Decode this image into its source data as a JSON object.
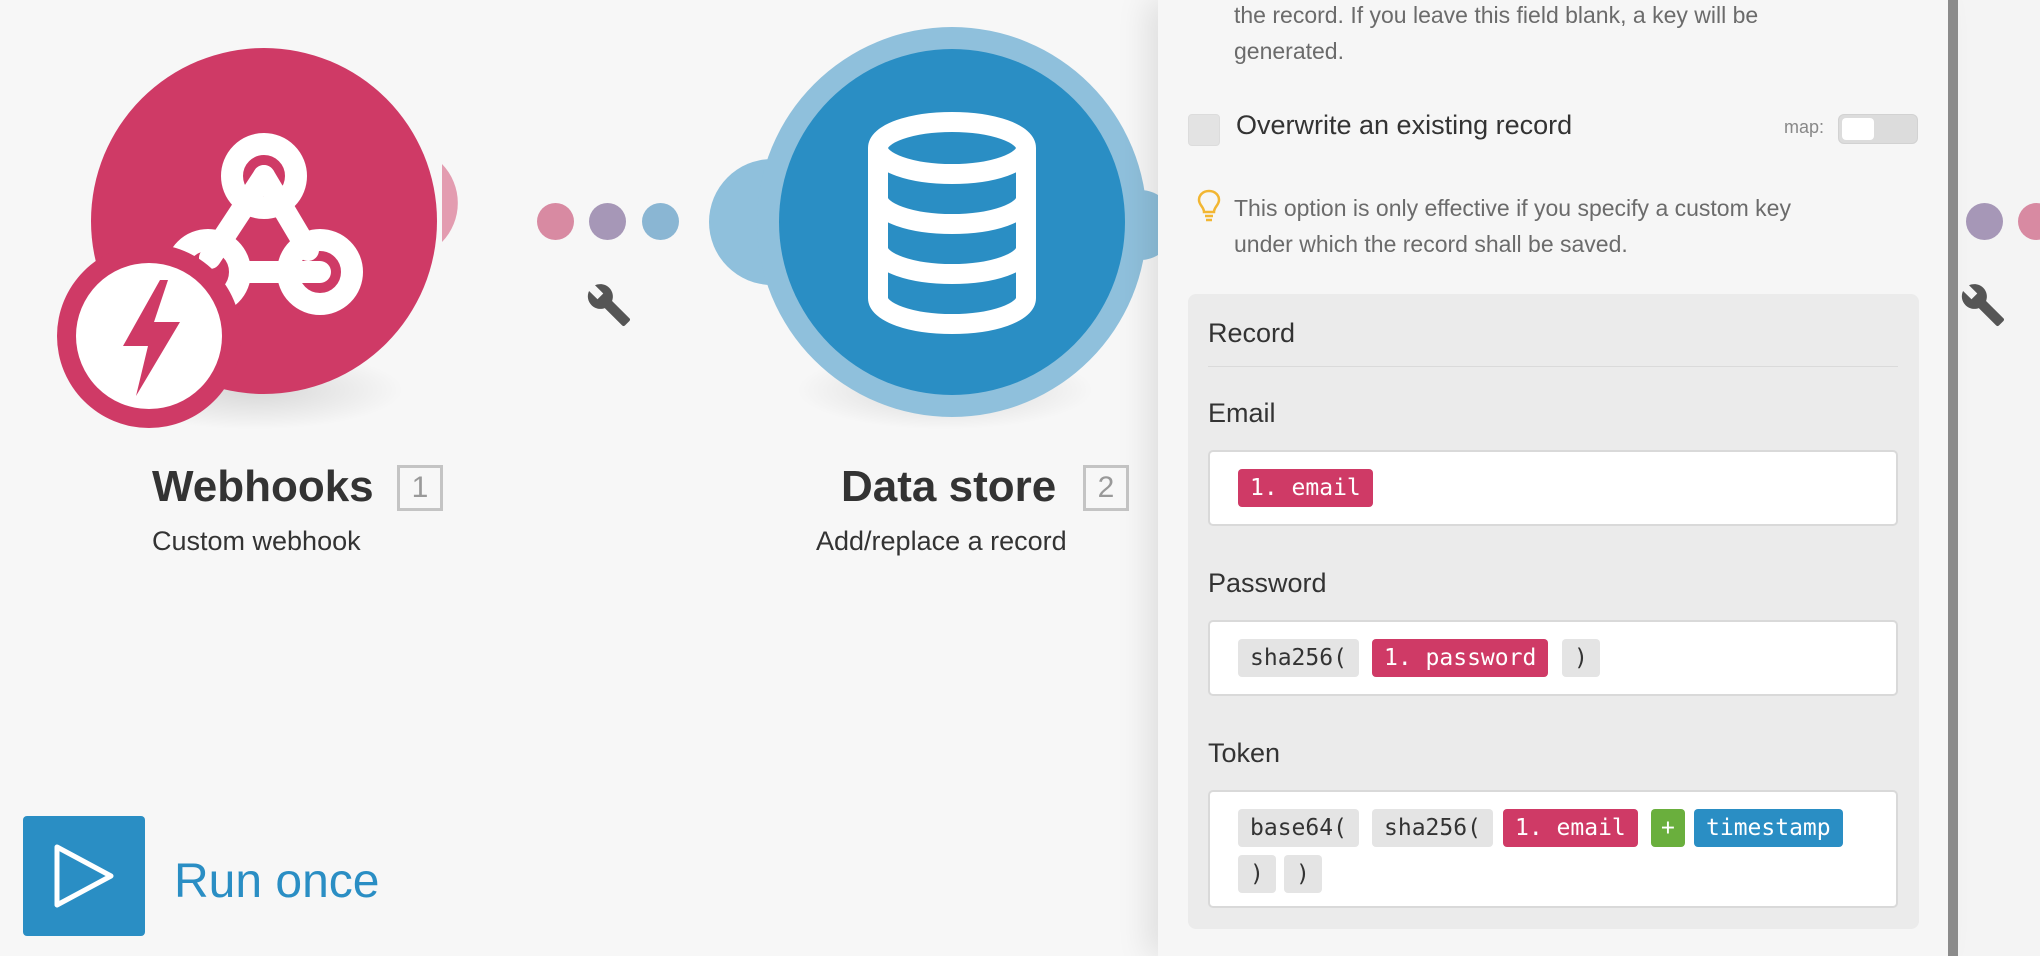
{
  "canvas": {
    "modules": [
      {
        "name": "Webhooks",
        "badge": "1",
        "subtitle": "Custom webhook",
        "color": "#cf3a66"
      },
      {
        "name": "Data store",
        "badge": "2",
        "subtitle": "Add/replace a record",
        "color": "#2a8ec4"
      }
    ],
    "run_once_label": "Run once",
    "icons": [
      "webhook-icon",
      "lightning-icon",
      "database-icon",
      "wrench-icon",
      "play-icon"
    ]
  },
  "panel": {
    "key_help": "the record. If you leave this field blank, a key will be generated.",
    "key_help_lines": [
      "the record. If you leave this field blank, a key will be",
      "generated."
    ],
    "overwrite_label": "Overwrite an existing record",
    "overwrite_checked": false,
    "map_label": "map:",
    "overwrite_help_lines": [
      "This option is only effective if you specify a custom key",
      "under which the record shall be saved."
    ],
    "record": {
      "title": "Record",
      "fields": [
        {
          "label": "Email",
          "tokens": [
            {
              "text": "1. email",
              "kind": "var"
            }
          ]
        },
        {
          "label": "Password",
          "tokens": [
            {
              "text": "sha256(",
              "kind": "fn"
            },
            {
              "text": "1. password",
              "kind": "var"
            },
            {
              "text": ")",
              "kind": "fn"
            }
          ]
        },
        {
          "label": "Token",
          "tokens": [
            {
              "text": "base64(",
              "kind": "fn"
            },
            {
              "text": "sha256(",
              "kind": "fn"
            },
            {
              "text": "1. email",
              "kind": "var"
            },
            {
              "text": "+",
              "kind": "op"
            },
            {
              "text": "timestamp",
              "kind": "kw"
            },
            {
              "text": ")",
              "kind": "fn"
            },
            {
              "text": ")",
              "kind": "fn"
            }
          ]
        }
      ]
    }
  },
  "colors": {
    "webhook": "#cf3a66",
    "datastore": "#2a8ec4",
    "dot_pink": "#d88aa2",
    "dot_purple": "#a697b7",
    "dot_blue": "#8ab6d3",
    "help_bulb": "#f2b632"
  }
}
